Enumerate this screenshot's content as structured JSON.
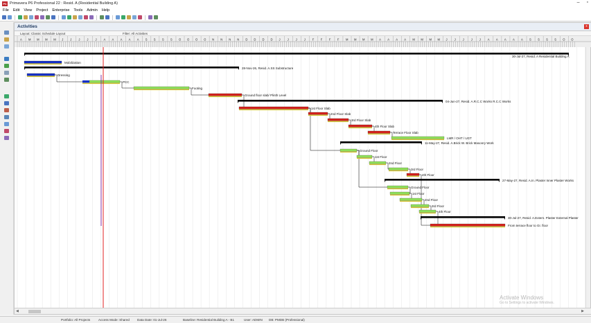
{
  "window": {
    "title": "Primavera P6 Professional 22 : Resid. A (Residential Building A)",
    "app_logo": "P6",
    "minimize": "–",
    "restore": "▫"
  },
  "menu": [
    "File",
    "Edit",
    "View",
    "Project",
    "Enterprise",
    "Tools",
    "Admin",
    "Help"
  ],
  "toolbar_icons": [
    "back-icon",
    "zoom-icon",
    "layout-icon",
    "filter-icon",
    "link-icon",
    "bar-icon",
    "schedule-icon",
    "level-icon",
    "store-icon",
    "columns-icon",
    "group-icon",
    "filter-funnel-icon",
    "sort-icon",
    "progress-icon",
    "print-icon",
    "dollar-icon",
    "assign-icon",
    "zoom-in-icon",
    "zoom-out-icon",
    "fit-icon",
    "expand-icon",
    "collapse-icon",
    "notes-icon",
    "chart-icon"
  ],
  "panel": {
    "title": "Activities",
    "close": "x",
    "layout_label": "Layout: Classic Schedule Layout",
    "filter_label": "Filter: All Activities"
  },
  "timescale": {
    "months": [
      "A",
      "M",
      "M",
      "M",
      "M",
      "J",
      "J",
      "J",
      "J",
      "J",
      "A",
      "A",
      "A",
      "A",
      "A",
      "S",
      "S",
      "S",
      "S",
      "O",
      "O",
      "O",
      "O",
      "N",
      "N",
      "N",
      "N",
      "D",
      "D",
      "D",
      "D",
      "J",
      "J",
      "J",
      "J",
      "F",
      "F",
      "F",
      "F",
      "M",
      "M",
      "M",
      "M",
      "A",
      "A",
      "A",
      "A",
      "M",
      "M",
      "M",
      "M",
      "J",
      "J",
      "J",
      "J",
      "J",
      "A",
      "A",
      "A",
      "A",
      "A",
      "S",
      "S",
      "S",
      "S",
      "O",
      "O"
    ]
  },
  "activities": [
    {
      "label": "30-Jul-27, Resid. A  Residential Building A",
      "type": "summary"
    },
    {
      "label": "Mobilization",
      "type": "complete"
    },
    {
      "label": "28-Nov-26, Resid. A.SS  Substructure",
      "type": "summary"
    },
    {
      "label": "Dressing",
      "type": "complete"
    },
    {
      "label": "PCC",
      "type": "mixed"
    },
    {
      "label": "Footing",
      "type": "green"
    },
    {
      "label": "Ground floor slab/ Plinth Level",
      "type": "critical"
    },
    {
      "label": "04-Jun-27, Resid. A.R.C.C Works  R.C.C Works",
      "type": "summary"
    },
    {
      "label": "1st Floor Slab",
      "type": "critical"
    },
    {
      "label": "2nd Floor Slab",
      "type": "critical"
    },
    {
      "label": "3rd Floor Slab",
      "type": "critical"
    },
    {
      "label": "4th Floor Slab",
      "type": "critical"
    },
    {
      "label": "Terrace Floor Slab",
      "type": "critical"
    },
    {
      "label": "LMR / OHT / UGT",
      "type": "green"
    },
    {
      "label": "11-May-27, Resid. A.Brick W.  Brick Masonry Work",
      "type": "summary"
    },
    {
      "label": "Ground Floor",
      "type": "green"
    },
    {
      "label": "1st Floor",
      "type": "green"
    },
    {
      "label": "2nd Floor",
      "type": "green"
    },
    {
      "label": "3rd Floor",
      "type": "green"
    },
    {
      "label": "4th Floor",
      "type": "critical"
    },
    {
      "label": "27-May-27, Resid. A.In. Plaster  Inner Plaster Works",
      "type": "summary"
    },
    {
      "label": "Ground Floor",
      "type": "green"
    },
    {
      "label": "1st Floor",
      "type": "green"
    },
    {
      "label": "2nd Floor",
      "type": "green"
    },
    {
      "label": "3rd Floor",
      "type": "green"
    },
    {
      "label": "4th Floor",
      "type": "green"
    },
    {
      "label": "30-Jul-27, Resid. A.Extern. Plaster  External Plaster",
      "type": "summary"
    },
    {
      "label": "From terrace floor to Gr. floor",
      "type": "critical"
    }
  ],
  "hscroll": {
    "left": "◀",
    "right": "▶"
  },
  "status": {
    "portfolio": "Portfolio: All Projects",
    "access_mode": "Access Mode: Shared",
    "data_date": "Data Date: 01-Jul-26",
    "baseline": "Baseline: Residential Building A - B1",
    "user": "User: ADMIN",
    "db": "DB: PMDB (Professional)"
  },
  "watermark": {
    "title": "Activate Windows",
    "subtitle": "Go to Settings to activate Windows."
  },
  "colors": {
    "critical": "#d4201c",
    "green": "#8fe05a",
    "baseline": "#d6c63a",
    "complete": "#1530c8",
    "summary": "#000000",
    "data_date": "#e02020",
    "progress_line": "#7a1ea0"
  }
}
